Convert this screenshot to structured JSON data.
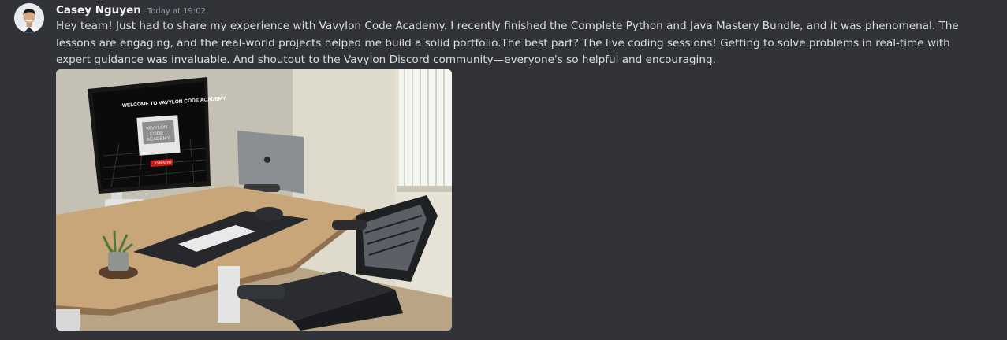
{
  "message": {
    "author": "Casey Nguyen",
    "timestamp": "Today at 19:02",
    "text": "Hey team! Just had to share my experience with Vavylon Code Academy. I recently finished the Complete Python and Java Mastery Bundle, and it was phenomenal. The lessons are engaging, and the real-world projects helped me build a solid portfolio.The best part? The live coding sessions! Getting to solve problems in real-time with expert guidance was invaluable. And shoutout to the Vavylon Discord community—everyone's so helpful and encouraging."
  },
  "image": {
    "screen_title": "WELCOME TO VAVYLON CODE ACADEMY",
    "logo_text_1": "VAVYLON",
    "logo_text_2": "CODE",
    "logo_text_3": "ACADEMY",
    "cta": "JOIN NOW"
  },
  "colors": {
    "background": "#313338",
    "author": "#f2f3f5",
    "text": "#dbdee1",
    "timestamp": "#949ba4"
  }
}
